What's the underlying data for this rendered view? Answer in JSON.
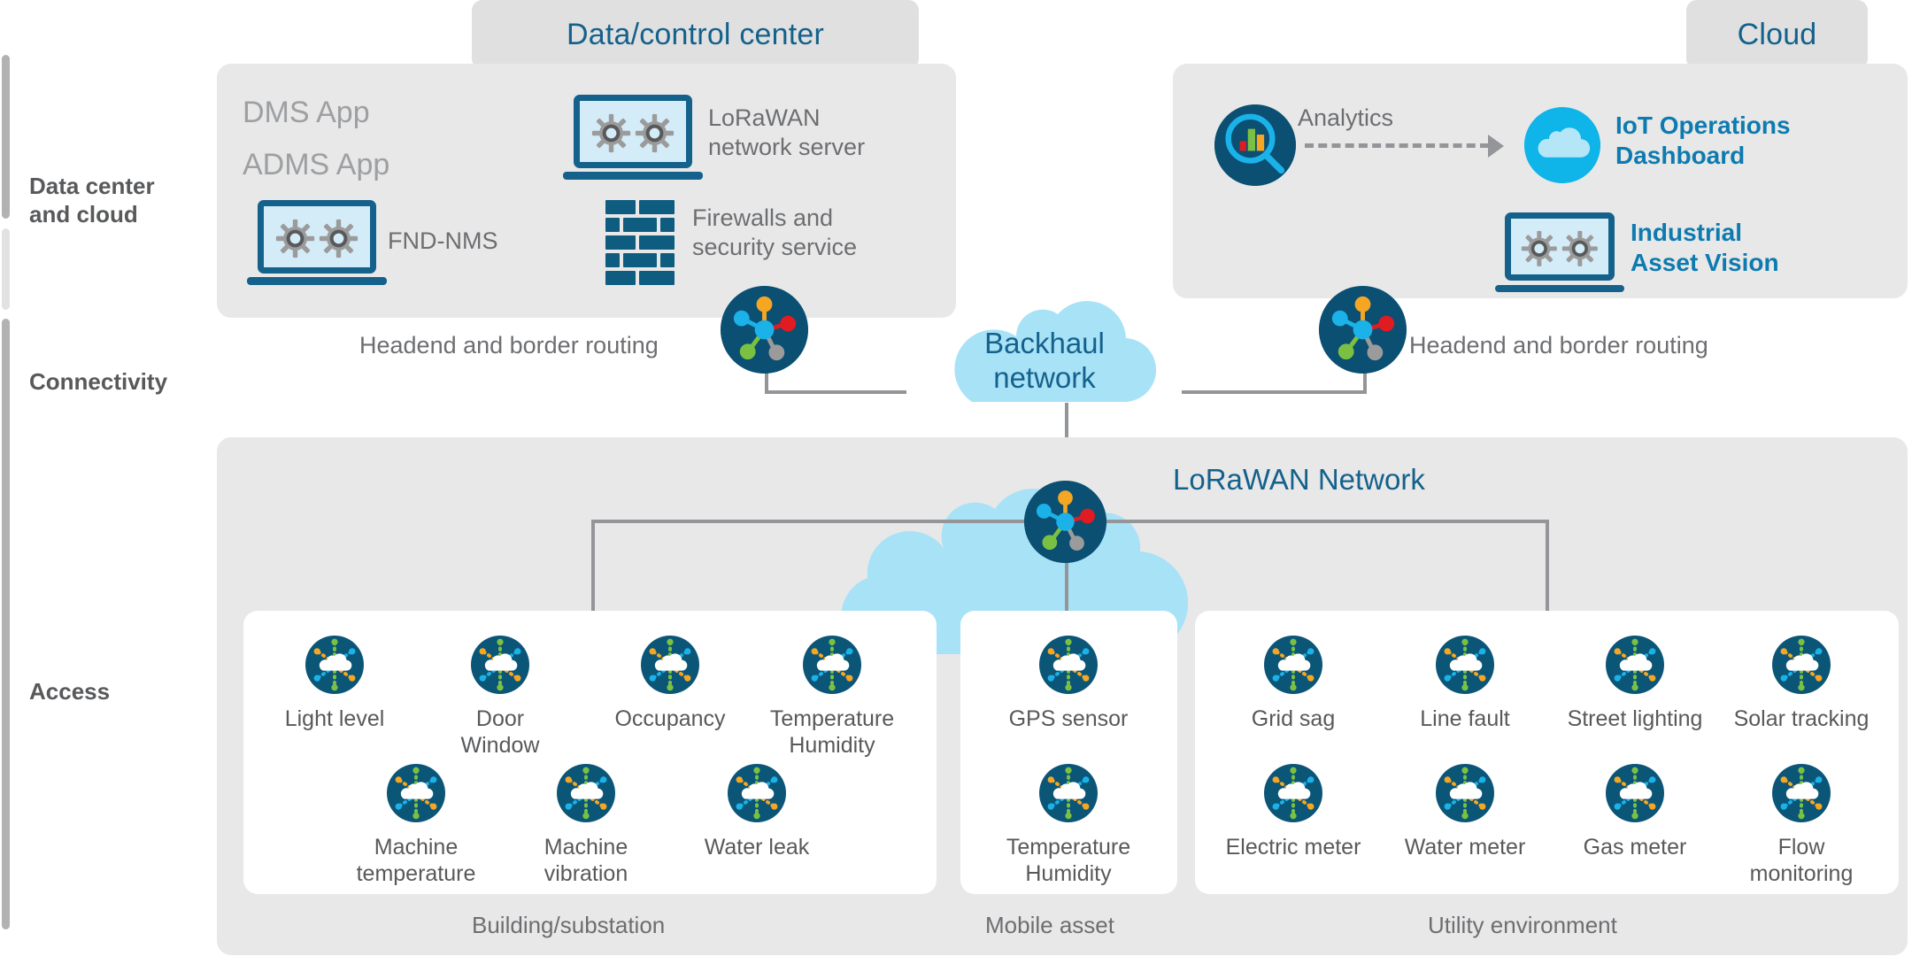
{
  "tiers": [
    {
      "label": "Data center\nand cloud",
      "name": "data-center-and-cloud"
    },
    {
      "label": "Connectivity",
      "name": "connectivity"
    },
    {
      "label": "Access",
      "name": "access"
    }
  ],
  "tier_labels": {
    "data_center": "Data center and cloud",
    "data_center_line1": "Data center",
    "data_center_line2": "and cloud",
    "connectivity": "Connectivity",
    "access": "Access"
  },
  "panels": {
    "data_control_center": {
      "tab_title": "Data/control center",
      "items": [
        {
          "name": "dms-app",
          "label": "DMS App",
          "icon": "none"
        },
        {
          "name": "adms-app",
          "label": "ADMS App",
          "icon": "none"
        },
        {
          "name": "fnd-nms",
          "label": "FND-NMS",
          "icon": "laptop-gears-icon"
        },
        {
          "name": "lorawan-network-server",
          "label_line1": "LoRaWAN",
          "label_line2": "network server",
          "icon": "laptop-gears-icon"
        },
        {
          "name": "firewalls-and-security-service",
          "label_line1": "Firewalls and",
          "label_line2": "security service",
          "icon": "firewall-brick-icon"
        }
      ]
    },
    "cloud": {
      "tab_title": "Cloud",
      "items": [
        {
          "name": "analytics",
          "label": "Analytics",
          "icon": "analytics-magnifier-icon"
        },
        {
          "name": "iot-operations-dashboard",
          "label_line1": "IoT Operations",
          "label_line2": "Dashboard",
          "icon": "cloud-circle-icon"
        },
        {
          "name": "industrial-asset-vision",
          "label_line1": "Industrial",
          "label_line2": "Asset Vision",
          "icon": "laptop-gears-icon"
        }
      ]
    }
  },
  "connectivity": {
    "headend_left": "Headend and border routing",
    "headend_right": "Headend and border routing",
    "backhaul_line1": "Backhaul",
    "backhaul_line2": "network"
  },
  "access": {
    "network_title": "LoRaWAN Network",
    "groups": [
      {
        "name": "building-substation",
        "caption": "Building/substation",
        "row1": [
          {
            "label_line1": "Light level",
            "label_line2": ""
          },
          {
            "label_line1": "Door",
            "label_line2": "Window"
          },
          {
            "label_line1": "Occupancy",
            "label_line2": ""
          },
          {
            "label_line1": "Temperature",
            "label_line2": "Humidity"
          }
        ],
        "row2": [
          {
            "label_line1": "Machine",
            "label_line2": "temperature"
          },
          {
            "label_line1": "Machine",
            "label_line2": "vibration"
          },
          {
            "label_line1": "Water leak",
            "label_line2": ""
          }
        ]
      },
      {
        "name": "mobile-asset",
        "caption": "Mobile asset",
        "row1": [
          {
            "label_line1": "GPS sensor",
            "label_line2": ""
          }
        ],
        "row2": [
          {
            "label_line1": "Temperature",
            "label_line2": "Humidity"
          }
        ]
      },
      {
        "name": "utility-environment",
        "caption": "Utility environment",
        "row1": [
          {
            "label_line1": "Grid sag",
            "label_line2": ""
          },
          {
            "label_line1": "Line fault",
            "label_line2": ""
          },
          {
            "label_line1": "Street lighting",
            "label_line2": ""
          },
          {
            "label_line1": "Solar tracking",
            "label_line2": ""
          }
        ],
        "row2": [
          {
            "label_line1": "Electric meter",
            "label_line2": ""
          },
          {
            "label_line1": "Water meter",
            "label_line2": ""
          },
          {
            "label_line1": "Gas meter",
            "label_line2": ""
          },
          {
            "label_line1": "Flow",
            "label_line2": "monitoring"
          }
        ]
      }
    ]
  },
  "colors": {
    "navy": "#14618c",
    "deep_blue": "#0b4f72",
    "cyan": "#0fb4e8",
    "light_cloud": "#a8e2f7",
    "panel_grey": "#e8e8e8",
    "tab_grey": "#e0e0e0",
    "text_grey": "#6d6e71",
    "line_grey": "#939598",
    "node_orange": "#f5a623",
    "node_red": "#e01b22",
    "node_green": "#7ac143",
    "node_gray": "#9b9b9b",
    "node_cyan": "#1ab2e8",
    "gear_grey": "#9b9b9b",
    "gear_dark": "#58595b"
  }
}
